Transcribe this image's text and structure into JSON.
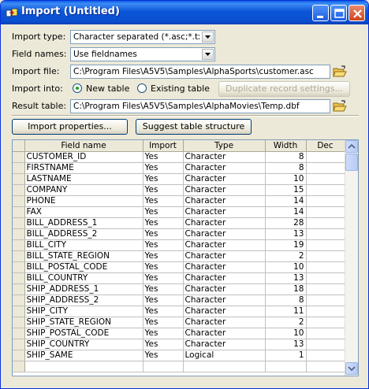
{
  "window": {
    "title": "Import (Untitled)"
  },
  "form": {
    "import_type": {
      "label": "Import type:",
      "value": "Character separated (*.asc;*.txt;*.c"
    },
    "field_names": {
      "label": "Field names:",
      "value": "Use fieldnames"
    },
    "import_file": {
      "label": "Import file:",
      "value": "C:\\Program Files\\A5V5\\Samples\\AlphaSports\\customer.asc"
    },
    "import_into": {
      "label": "Import into:",
      "new_table": "New table",
      "existing_table": "Existing table",
      "selected": "new_table"
    },
    "duplicate_button": "Duplicate record settings...",
    "result_table": {
      "label": "Result table:",
      "value": "C:\\Program Files\\A5V5\\Samples\\AlphaMovies\\Temp.dbf"
    }
  },
  "buttons": {
    "import_properties": "Import properties...",
    "suggest_structure": "Suggest table structure"
  },
  "grid": {
    "columns": [
      "Field name",
      "Import",
      "Type",
      "Width",
      "Dec"
    ],
    "rows": [
      [
        "CUSTOMER_ID",
        "Yes",
        "Character",
        "8",
        ""
      ],
      [
        "FIRSTNAME",
        "Yes",
        "Character",
        "8",
        ""
      ],
      [
        "LASTNAME",
        "Yes",
        "Character",
        "10",
        ""
      ],
      [
        "COMPANY",
        "Yes",
        "Character",
        "15",
        ""
      ],
      [
        "PHONE",
        "Yes",
        "Character",
        "14",
        ""
      ],
      [
        "FAX",
        "Yes",
        "Character",
        "14",
        ""
      ],
      [
        "BILL_ADDRESS_1",
        "Yes",
        "Character",
        "28",
        ""
      ],
      [
        "BILL_ADDRESS_2",
        "Yes",
        "Character",
        "13",
        ""
      ],
      [
        "BILL_CITY",
        "Yes",
        "Character",
        "19",
        ""
      ],
      [
        "BILL_STATE_REGION",
        "Yes",
        "Character",
        "2",
        ""
      ],
      [
        "BILL_POSTAL_CODE",
        "Yes",
        "Character",
        "10",
        ""
      ],
      [
        "BILL_COUNTRY",
        "Yes",
        "Character",
        "13",
        ""
      ],
      [
        "SHIP_ADDRESS_1",
        "Yes",
        "Character",
        "18",
        ""
      ],
      [
        "SHIP_ADDRESS_2",
        "Yes",
        "Character",
        "8",
        ""
      ],
      [
        "SHIP_CITY",
        "Yes",
        "Character",
        "11",
        ""
      ],
      [
        "SHIP_STATE_REGION",
        "Yes",
        "Character",
        "2",
        ""
      ],
      [
        "SHIP_POSTAL_CODE",
        "Yes",
        "Character",
        "10",
        ""
      ],
      [
        "SHIP_COUNTRY",
        "Yes",
        "Character",
        "13",
        ""
      ],
      [
        "SHIP_SAME",
        "Yes",
        "Logical",
        "1",
        ""
      ],
      [
        "",
        "",
        "",
        "",
        ""
      ]
    ]
  }
}
